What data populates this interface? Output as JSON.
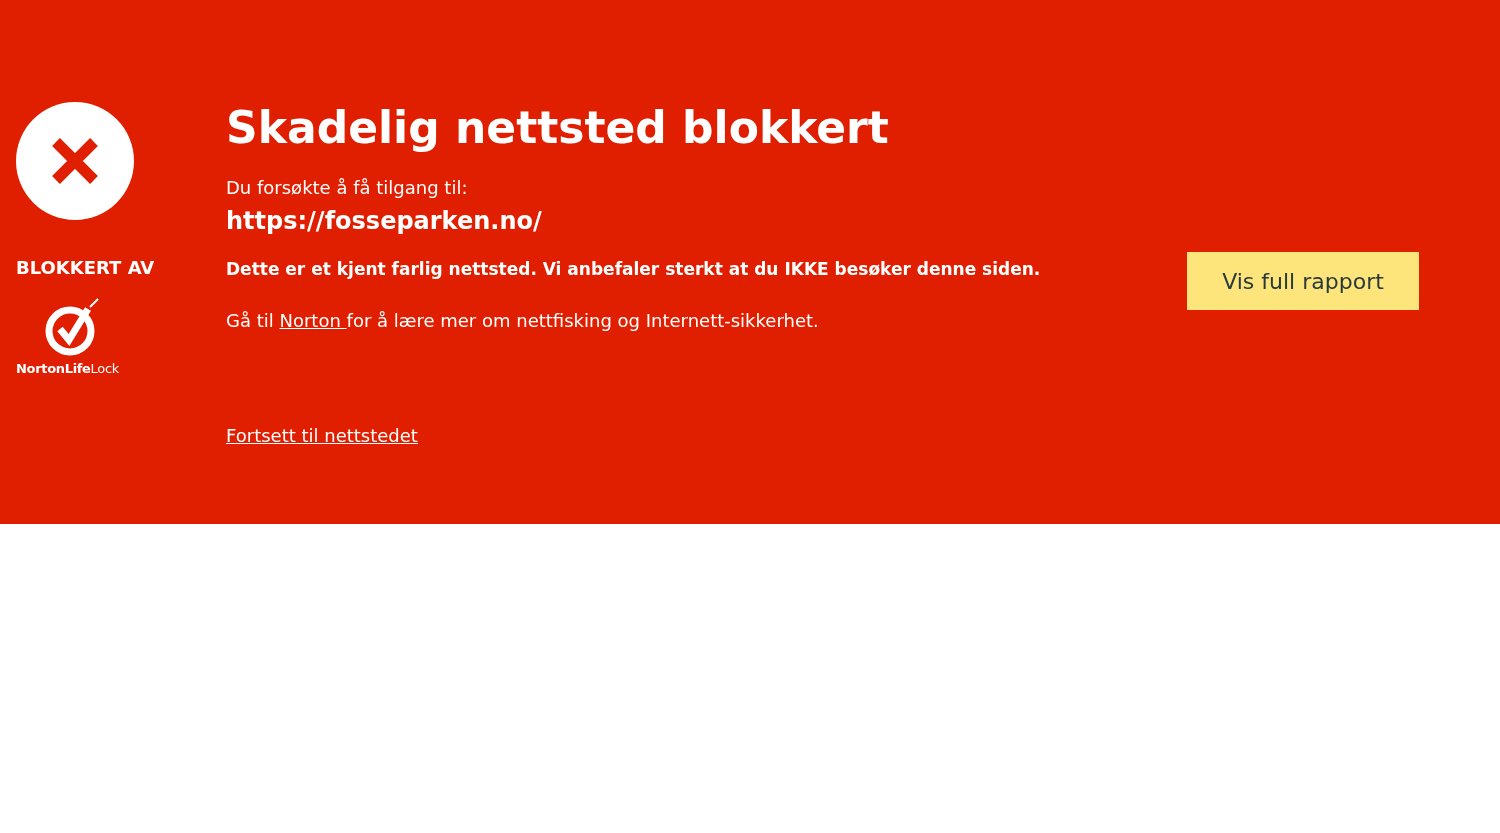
{
  "sidebar": {
    "blocked_by_label": "BLOKKERT AV",
    "logo_text": "**NortonLife**Lock"
  },
  "title": "Skadelig nettsted blokkert",
  "attempt_label": "Du forsøkte å få tilgang til:",
  "url": "https://fosseparken.no/",
  "warning": "Dette er et kjent farlig nettsted. Vi anbefaler sterkt at du IKKE besøker denne siden.",
  "info": {
    "before": "Gå til ",
    "link": "Norton ",
    "after": "for å lære mer om nettfisking og Internett-sikkerhet."
  },
  "report_button": "Vis full rapport",
  "continue_link": "Fortsett til nettstedet"
}
